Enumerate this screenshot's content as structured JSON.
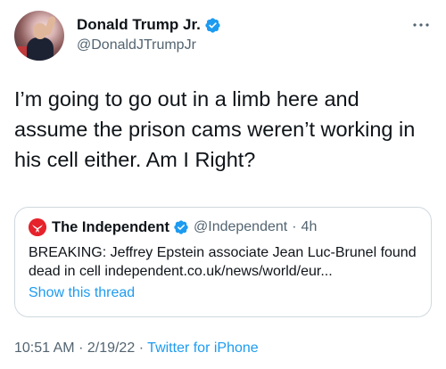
{
  "author": {
    "display_name": "Donald Trump Jr.",
    "handle": "@DonaldJTrumpJr",
    "verified": true
  },
  "tweet": {
    "text": "I’m going to go out in a limb here and assume the prison cams weren’t working in his cell either. Am I Right?"
  },
  "quote": {
    "display_name": "The Independent",
    "handle": "@Independent",
    "separator": "·",
    "age": "4h",
    "text": "BREAKING: Jeffrey Epstein associate Jean Luc-Brunel found dead in cell independent.co.uk/news/world/eur...",
    "show_thread": "Show this thread"
  },
  "meta": {
    "time": "10:51 AM",
    "separator_1": "·",
    "date": "2/19/22",
    "separator_2": "·",
    "source": "Twitter for iPhone"
  },
  "colors": {
    "accent": "#1d9bf0",
    "text": "#0f1419",
    "secondary": "#536471",
    "border": "#cfd9de",
    "independent_red": "#e6222a"
  },
  "icons": {
    "verified": "verified-badge-icon",
    "more": "more-horizontal-icon",
    "independent_logo": "independent-eagle-icon"
  }
}
